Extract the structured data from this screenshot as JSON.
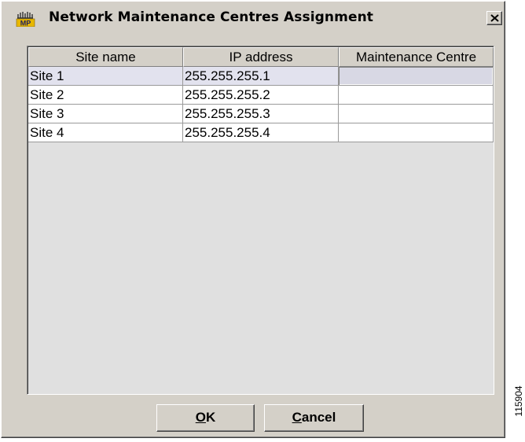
{
  "window": {
    "title": "Network Maintenance Centres Assignment",
    "icon": "mp-app-icon",
    "close_icon": "close-icon"
  },
  "table": {
    "columns": [
      "Site name",
      "IP address",
      "Maintenance Centre"
    ],
    "rows": [
      {
        "site": "Site 1",
        "ip": "255.255.255.1",
        "centre": ""
      },
      {
        "site": "Site 2",
        "ip": "255.255.255.2",
        "centre": ""
      },
      {
        "site": "Site 3",
        "ip": "255.255.255.3",
        "centre": ""
      },
      {
        "site": "Site 4",
        "ip": "255.255.255.4",
        "centre": ""
      }
    ],
    "selected_row": 1
  },
  "buttons": {
    "ok": {
      "accel": "O",
      "rest": "K"
    },
    "cancel": {
      "accel": "C",
      "rest": "ancel"
    }
  },
  "figure_code": "115904",
  "colors": {
    "dialog_bg": "#d4d0c8",
    "selected_row": "#e2e2ee",
    "panel_bg": "#e0e0e0"
  }
}
